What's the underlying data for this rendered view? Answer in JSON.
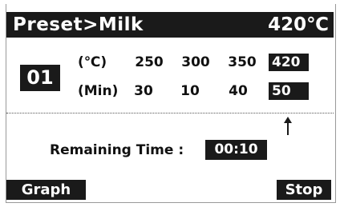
{
  "header": {
    "title": "Preset>Milk",
    "current_temp": "420℃"
  },
  "program": {
    "step_number": "01",
    "temp_row_label": "(℃)",
    "time_row_label": "(Min)",
    "temps": [
      "250",
      "300",
      "350",
      "420"
    ],
    "times": [
      "30",
      "10",
      "40",
      "50"
    ],
    "selected_index": 3
  },
  "status": {
    "remaining_label": "Remaining Time :",
    "remaining_value": "00:10"
  },
  "softkeys": {
    "left_label": "Graph",
    "right_label": "Stop"
  },
  "icons": {
    "cursor": "up-arrow-icon"
  },
  "colors": {
    "foreground": "#1a1a1a",
    "background": "#ffffff"
  }
}
